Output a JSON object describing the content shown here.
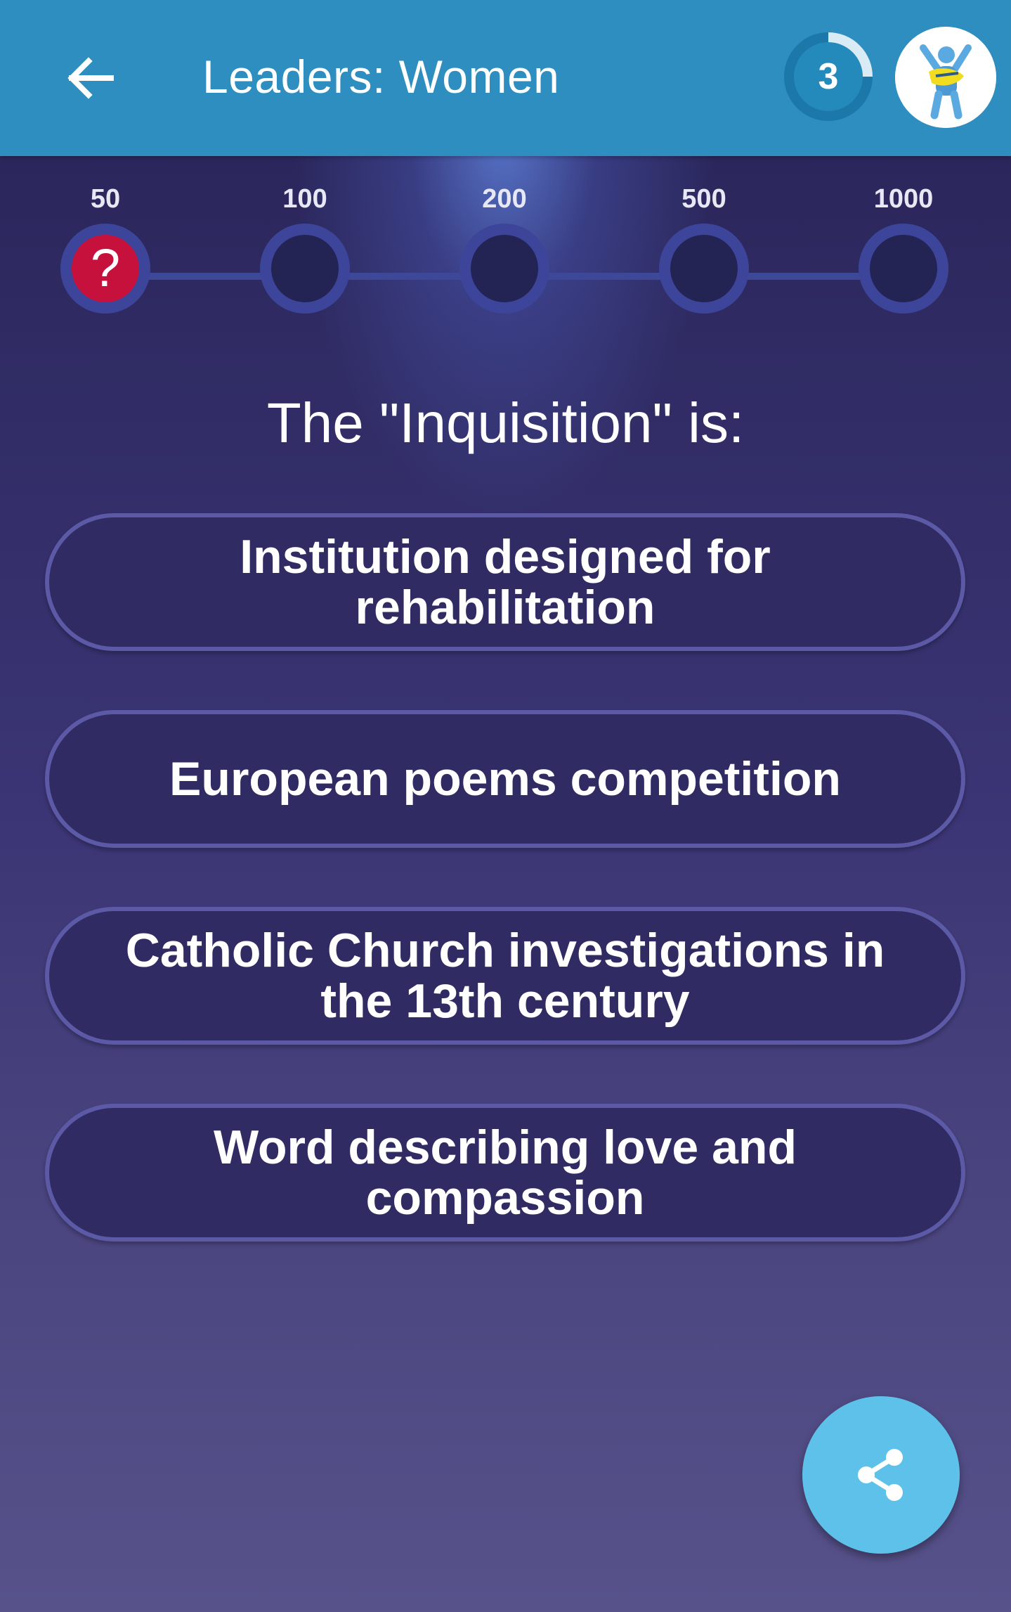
{
  "header": {
    "title": "Leaders: Women",
    "timer_value": "3",
    "timer_progress": 0.3
  },
  "ladder": {
    "steps": [
      {
        "value": "50",
        "current": true,
        "marker": "?"
      },
      {
        "value": "100",
        "current": false
      },
      {
        "value": "200",
        "current": false
      },
      {
        "value": "500",
        "current": false
      },
      {
        "value": "1000",
        "current": false
      }
    ]
  },
  "question": {
    "text": "The \"Inquisition\" is:"
  },
  "answers": [
    "Institution designed for rehabilitation",
    "European poems competition",
    "Catholic Church investigations in the 13th century",
    "Word describing love and compassion"
  ],
  "icons": {
    "back": "arrow-left-icon",
    "share": "share-icon",
    "avatar": "avatar-figure-icon"
  },
  "colors": {
    "app_bar": "#2d8ebf",
    "current_step": "#c6113c",
    "share_button": "#5ec1ea",
    "answer_border": "#5c5aa6"
  }
}
